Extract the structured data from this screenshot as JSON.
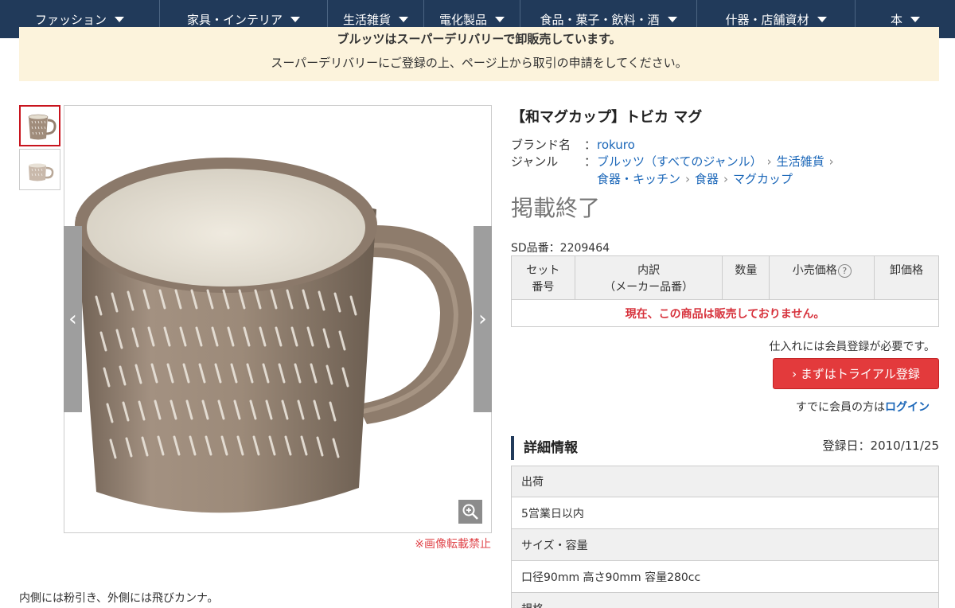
{
  "nav": {
    "items": [
      {
        "label": "ファッション"
      },
      {
        "label": "家具・インテリア"
      },
      {
        "label": "生活雑貨"
      },
      {
        "label": "電化製品"
      },
      {
        "label": "食品・菓子・飲料・酒"
      },
      {
        "label": "什器・店舗資材"
      },
      {
        "label": "本"
      }
    ]
  },
  "notice": {
    "line1": "ブルッツはスーパーデリバリーで卸販売しています。",
    "line2": "スーパーデリバリーにご登録の上、ページ上から取引の申請をしてください。"
  },
  "gallery": {
    "prev_glyph": "‹",
    "next_glyph": "›",
    "no_reproduction": "※画像転載禁止",
    "description": "内側には粉引き、外側には飛びカンナ。"
  },
  "product": {
    "title": "【和マグカップ】トビカ マグ",
    "brand_label": "ブランド名",
    "brand_value": "rokuro",
    "genre_label": "ジャンル",
    "colon": "：",
    "genre_path": [
      "ブルッツ（すべてのジャンル）",
      "生活雑貨",
      "食器・キッチン",
      "食器",
      "マグカップ"
    ],
    "status": "掲載終了",
    "sd_number": "SD品番：2209464"
  },
  "sets_table": {
    "headers": [
      "セット\n番号",
      "内訳\n（メーカー品番）",
      "数量",
      "小売価格",
      "卸価格"
    ],
    "help_glyph": "?",
    "message": "現在、この商品は販売しておりません。"
  },
  "membership": {
    "need_text": "仕入れには会員登録が必要です。",
    "trial_button": "› まずはトライアル登録",
    "already_text": "すでに会員の方は",
    "login_link": "ログイン"
  },
  "details": {
    "heading": "詳細情報",
    "registered": "登録日：2010/11/25",
    "rows": [
      {
        "label": "出荷",
        "value": "5営業日以内"
      },
      {
        "label": "サイズ・容量",
        "value": "口径90mm 高さ90mm 容量280cc"
      }
    ],
    "next_label": "規格"
  },
  "colors": {
    "nav_bg": "#213a5a",
    "notice_bg": "#fcf3dc",
    "accent_red": "#e33a3c",
    "link_blue": "#1a66b8"
  }
}
